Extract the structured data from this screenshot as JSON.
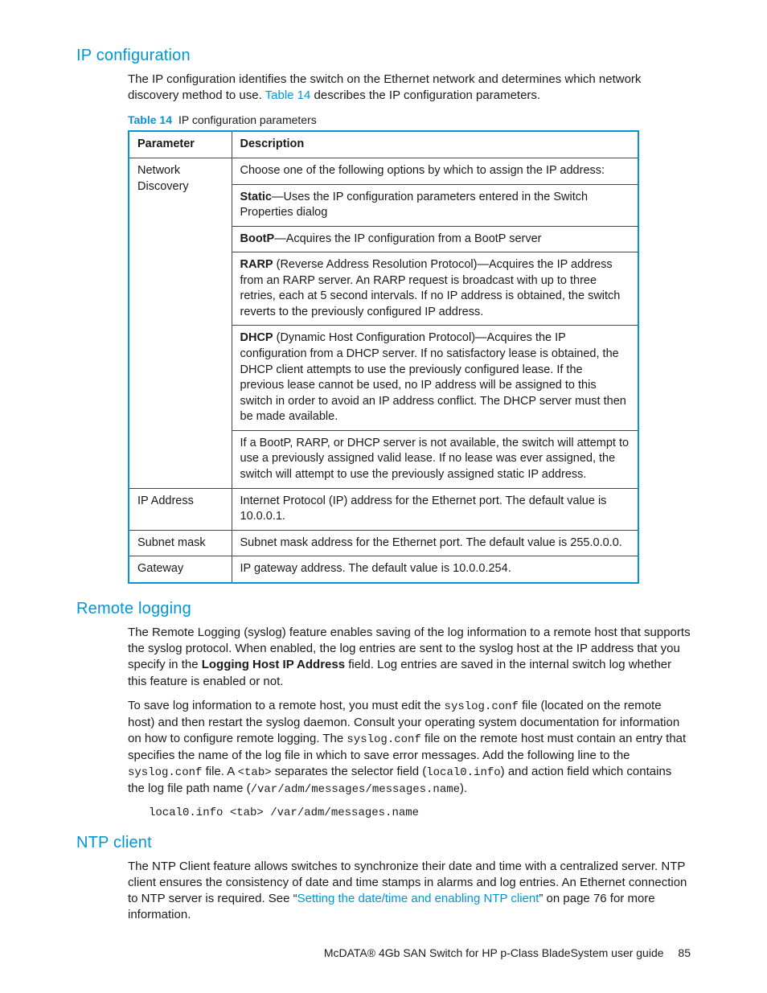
{
  "sections": {
    "ip_config": {
      "title": "IP configuration",
      "intro_before_link": "The IP configuration identifies the switch on the Ethernet network and determines which network discovery method to use. ",
      "intro_link": "Table 14",
      "intro_after_link": " describes the IP configuration parameters.",
      "table_caption_label": "Table 14",
      "table_caption_text": "IP configuration parameters",
      "table": {
        "headers": {
          "param": "Parameter",
          "desc": "Description"
        },
        "rows": {
          "network_discovery": {
            "param": "Network Discovery",
            "intro": "Choose one of the following options by which to assign the IP address:",
            "static_label": "Static",
            "static_text": "—Uses the IP configuration parameters entered in the Switch Properties dialog",
            "bootp_label": "BootP",
            "bootp_text": "—Acquires the IP configuration from a BootP server",
            "rarp_label": "RARP",
            "rarp_text": " (Reverse Address Resolution Protocol)—Acquires the IP address from an RARP server. An RARP request is broadcast with up to three retries, each at 5 second intervals. If no IP address is obtained, the switch reverts to the previously configured IP address.",
            "dhcp_label": "DHCP",
            "dhcp_text": " (Dynamic Host Configuration Protocol)—Acquires the IP configuration from a DHCP server. If no satisfactory lease is obtained, the DHCP client attempts to use the previously configured lease. If the previous lease cannot be used, no IP address will be assigned to this switch in order to avoid an IP address conflict. The DHCP server must then be made available.",
            "fallback": "If a BootP, RARP, or DHCP server is not available, the switch will attempt to use a previously assigned valid lease. If no lease was ever assigned, the switch will attempt to use the previously assigned static IP address."
          },
          "ip_address": {
            "param": "IP Address",
            "desc": "Internet Protocol (IP) address for the Ethernet port. The default value is 10.0.0.1."
          },
          "subnet": {
            "param": "Subnet mask",
            "desc": "Subnet mask address for the Ethernet port. The default value is 255.0.0.0."
          },
          "gateway": {
            "param": "Gateway",
            "desc": "IP gateway address. The default value is 10.0.0.254."
          }
        }
      }
    },
    "remote_logging": {
      "title": "Remote logging",
      "p1a": "The Remote Logging (syslog) feature enables saving of the log information to a remote host that supports the syslog protocol. When enabled, the log entries are sent to the syslog host at the IP address that you specify in the ",
      "p1b_bold": "Logging Host IP Address",
      "p1c": " field. Log entries are saved in the internal switch log whether this feature is enabled or not.",
      "p2a": "To save log information to a remote host, you must edit the ",
      "p2b_code": "syslog.conf",
      "p2c": " file (located on the remote host) and then restart the syslog daemon. Consult your operating system documentation for information on how to configure remote logging. The ",
      "p2d_code": "syslog.conf",
      "p2e": " file on the remote host must contain an entry that specifies the name of the log file in which to save error messages. Add the following line to the ",
      "p2f_code": "syslog.conf",
      "p2g": " file. A ",
      "p2h_code": "<tab>",
      "p2i": " separates the selector field (",
      "p2j_code": "local0.info",
      "p2k": ") and action field which contains the log file path name (",
      "p2l_code": "/var/adm/messages/messages.name",
      "p2m": ").",
      "code": "local0.info <tab> /var/adm/messages.name"
    },
    "ntp_client": {
      "title": "NTP client",
      "p_before": "The NTP Client feature allows switches to synchronize their date and time with a centralized server. NTP client ensures the consistency of date and time stamps in alarms and log entries. An Ethernet connection to NTP server is required. See “",
      "p_link": "Setting the date/time and enabling NTP client",
      "p_after": "” on page 76 for more information."
    }
  },
  "footer": {
    "text": "McDATA® 4Gb SAN Switch for HP p-Class BladeSystem user guide",
    "page": "85"
  }
}
